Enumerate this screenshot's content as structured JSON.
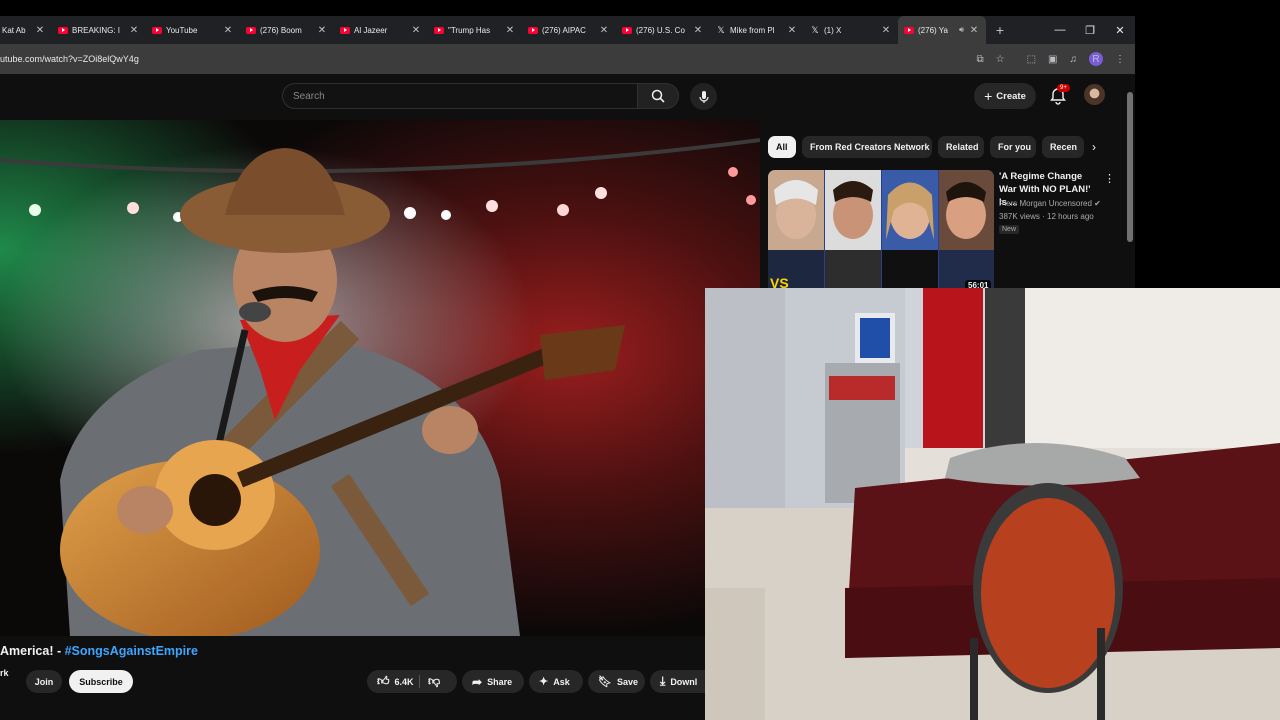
{
  "browser": {
    "tabs": [
      {
        "label": "Kat Ab",
        "icon": "tab-favicon"
      },
      {
        "label": "BREAKING: I",
        "icon": "youtube-icon"
      },
      {
        "label": "YouTube",
        "icon": "youtube-icon"
      },
      {
        "label": "(276) Boom",
        "icon": "youtube-icon"
      },
      {
        "label": "Al Jazeer",
        "icon": "youtube-icon"
      },
      {
        "label": "\"Trump Has",
        "icon": "youtube-icon"
      },
      {
        "label": "(276) AIPAC",
        "icon": "youtube-icon"
      },
      {
        "label": "(276) U.S. Co",
        "icon": "youtube-icon"
      },
      {
        "label": "Mike from Pl",
        "icon": "x-icon"
      },
      {
        "label": "(1) X",
        "icon": "x-icon"
      },
      {
        "label": "(276) Ya",
        "icon": "youtube-icon",
        "active": true
      }
    ],
    "url": "utube.com/watch?v=ZOi8elQwY4g",
    "profile_initial": "R"
  },
  "yt_header": {
    "search_placeholder": "Search",
    "create_label": "Create",
    "notifications_badge": "9+"
  },
  "video": {
    "title_prefix": "America! - ",
    "title_hashtag": "#SongsAgainstEmpire",
    "channel_fragment": "rk",
    "join_label": "Join",
    "subscribe_label": "Subscribe",
    "like_count": "6.4K",
    "share_label": "Share",
    "ask_label": "Ask",
    "save_label": "Save",
    "download_label": "Downl"
  },
  "sidebar": {
    "chips": [
      "All",
      "From Red Creators Network",
      "Related",
      "For you",
      "Recen"
    ],
    "recommendation": {
      "title": "'A Regime Change War With NO PLAN!' Is ...",
      "channel": "Piers Morgan Uncensored",
      "meta": "387K views · 12 hours ago",
      "badge": "New",
      "duration": "56:01"
    }
  },
  "colors": {
    "background": "#0f0f0f",
    "accent_red": "#ff0033",
    "hashtag_blue": "#3ea6ff",
    "chip_active": "#f1f1f1"
  }
}
